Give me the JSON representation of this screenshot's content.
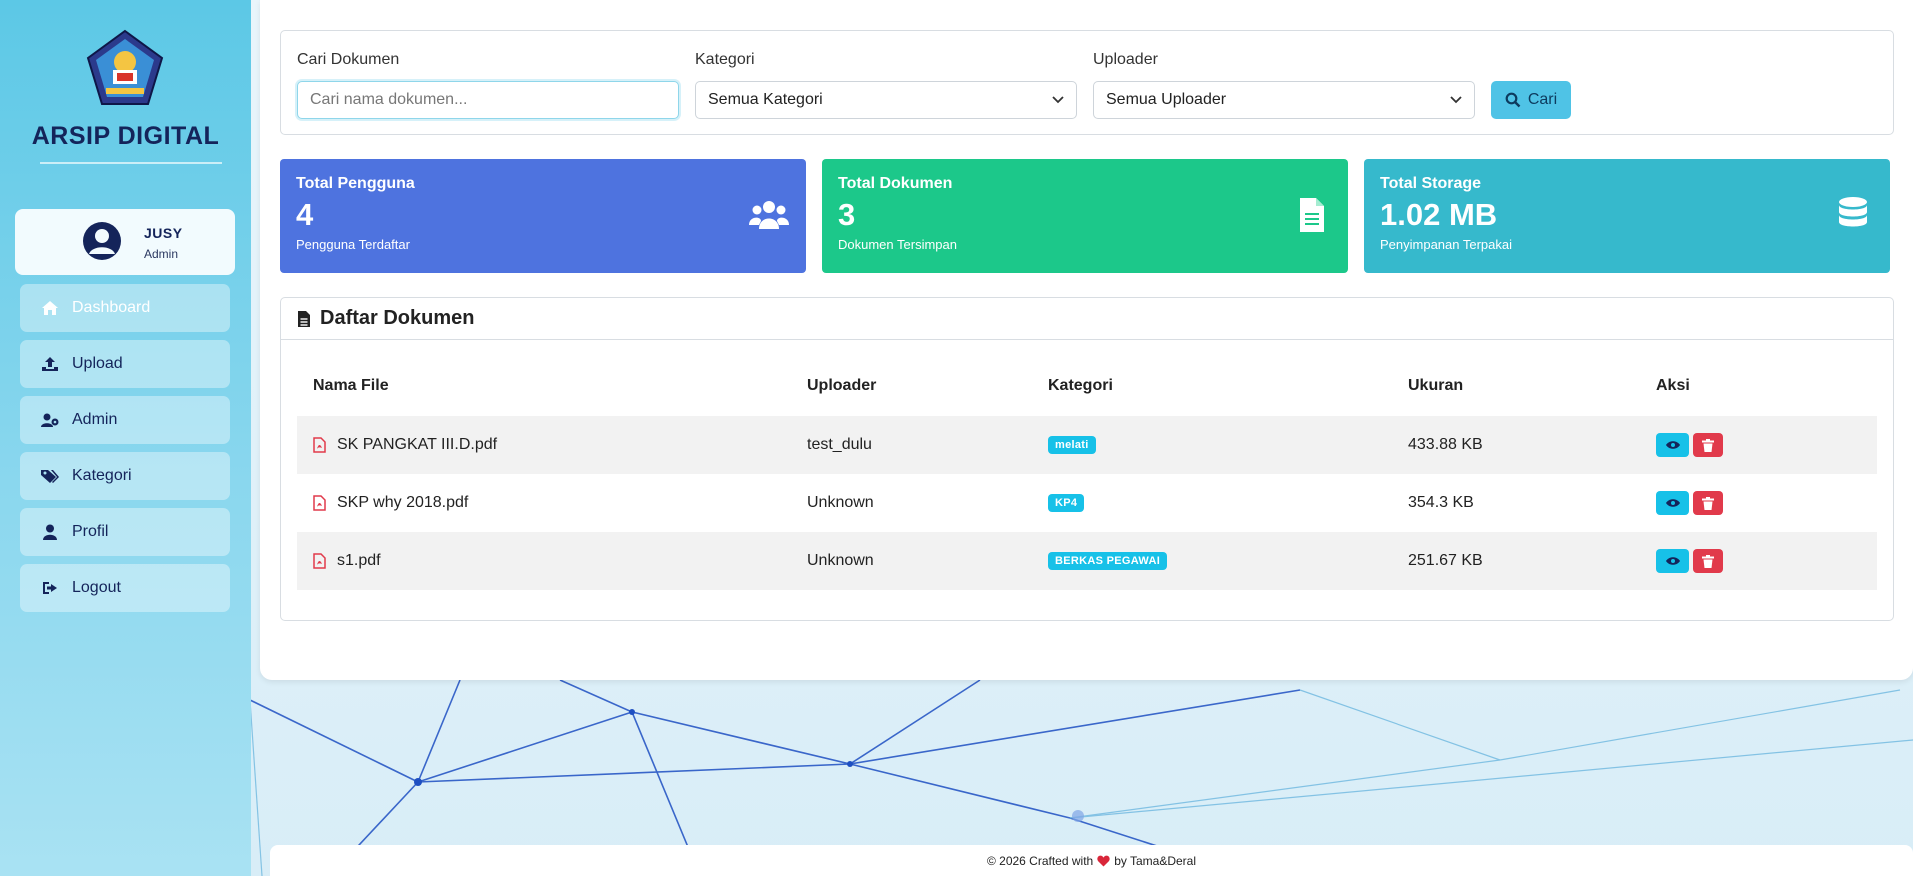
{
  "app": {
    "brand": "ARSIP DIGITAL"
  },
  "user": {
    "name": "JUSY",
    "role": "Admin"
  },
  "nav": [
    {
      "label": "Dashboard",
      "icon": "home-icon"
    },
    {
      "label": "Upload",
      "icon": "upload-icon"
    },
    {
      "label": "Admin",
      "icon": "users-cog-icon"
    },
    {
      "label": "Kategori",
      "icon": "tags-icon"
    },
    {
      "label": "Profil",
      "icon": "user-icon"
    },
    {
      "label": "Logout",
      "icon": "sign-out-icon"
    }
  ],
  "filters": {
    "search_label": "Cari Dokumen",
    "search_placeholder": "Cari nama dokumen...",
    "search_value": "",
    "category_label": "Kategori",
    "category_value": "Semua Kategori",
    "uploader_label": "Uploader",
    "uploader_value": "Semua Uploader",
    "search_button": "Cari"
  },
  "stats": [
    {
      "title": "Total Pengguna",
      "value": "4",
      "sub": "Pengguna Terdaftar",
      "color": "#4e73df",
      "icon": "users-icon"
    },
    {
      "title": "Total Dokumen",
      "value": "3",
      "sub": "Dokumen Tersimpan",
      "color": "#1cc88a",
      "icon": "file-icon"
    },
    {
      "title": "Total Storage",
      "value": "1.02 MB",
      "sub": "Penyimpanan Terpakai",
      "color": "#36b9cc",
      "icon": "database-icon"
    }
  ],
  "documents": {
    "title": "Daftar Dokumen",
    "columns": [
      "Nama File",
      "Uploader",
      "Kategori",
      "Ukuran",
      "Aksi"
    ],
    "rows": [
      {
        "file": "SK PANGKAT III.D.pdf",
        "uploader": "test_dulu",
        "category": "melati",
        "size": "433.88 KB"
      },
      {
        "file": "SKP why 2018.pdf",
        "uploader": "Unknown",
        "category": "KP4",
        "size": "354.3 KB"
      },
      {
        "file": "s1.pdf",
        "uploader": "Unknown",
        "category": "BERKAS PEGAWAI",
        "size": "251.67 KB"
      }
    ]
  },
  "footer": {
    "prefix": "© 2026 Crafted with",
    "suffix": "by Tama&Deral"
  },
  "colors": {
    "sidebar_top": "#5cc8e6",
    "navy": "#14245a",
    "badge": "#17c1e8",
    "danger": "#e13a4b",
    "button": "#4fc3e6"
  }
}
